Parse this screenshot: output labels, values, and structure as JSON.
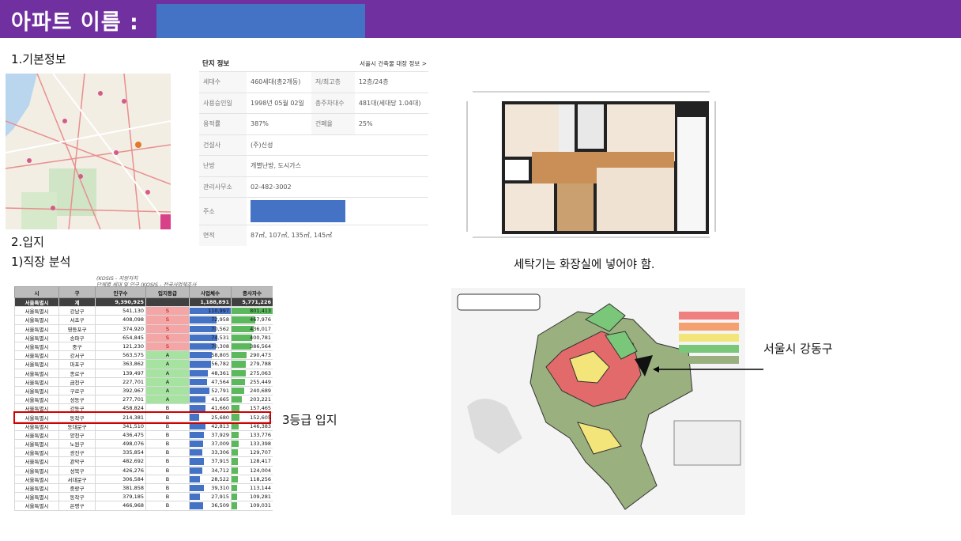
{
  "header": {
    "title": "아파트 이름 :"
  },
  "labels": {
    "basic_info": "1.기본정보",
    "location": "2.입지",
    "job_analysis": "1)직장 분석",
    "grade_note": "3등급 입지",
    "washer_note": "세탁기는 화장실에 넣어야 함.",
    "district_note": "서울시 강동구"
  },
  "complex_info": {
    "title": "단지 정보",
    "link": "서울시 건축물 대장 정보 >",
    "rows": [
      {
        "k1": "세대수",
        "v1": "460세대(총2개동)",
        "k2": "저/최고층",
        "v2": "12층/24층"
      },
      {
        "k1": "사용승인일",
        "v1": "1998년 05월 02일",
        "k2": "총주차대수",
        "v2": "481대(세대당 1.04대)"
      },
      {
        "k1": "용적률",
        "v1": "387%",
        "k2": "건폐율",
        "v2": "25%"
      },
      {
        "k1": "건설사",
        "v1": "(주)신성"
      },
      {
        "k1": "난방",
        "v1": "개별난방, 도시가스"
      },
      {
        "k1": "관리사무소",
        "v1": "02-482-3002"
      },
      {
        "k1": "주소",
        "v1": ""
      },
      {
        "k1": "면적",
        "v1": "87㎡, 107㎡, 135㎡, 145㎡"
      }
    ]
  },
  "job_table": {
    "source1": "(KOSIS - 지방자치",
    "source2": "단체별 세대 및 인구 (KOSIS - 전국사업체조사",
    "columns": [
      "시",
      "구",
      "인구수",
      "입지등급",
      "사업체수",
      "종사자수"
    ],
    "total": {
      "si": "서울특별시",
      "gu": "계",
      "pop": "9,390,925",
      "biz": "1,188,891",
      "emp": "5,771,226"
    },
    "rows": [
      {
        "si": "서울특별시",
        "gu": "강남구",
        "pop": "541,130",
        "grade": "S",
        "biz": "110,997",
        "emp": "801,413",
        "bizv": 110997,
        "empv": 801413
      },
      {
        "si": "서울특별시",
        "gu": "서초구",
        "pop": "408,098",
        "grade": "S",
        "biz": "72,958",
        "emp": "467,976",
        "bizv": 72958,
        "empv": 467976
      },
      {
        "si": "서울특별시",
        "gu": "영등포구",
        "pop": "374,920",
        "grade": "S",
        "biz": "70,562",
        "emp": "436,017",
        "bizv": 70562,
        "empv": 436017
      },
      {
        "si": "서울특별시",
        "gu": "송파구",
        "pop": "654,845",
        "grade": "S",
        "biz": "74,531",
        "emp": "400,781",
        "bizv": 74531,
        "empv": 400781
      },
      {
        "si": "서울특별시",
        "gu": "중구",
        "pop": "121,230",
        "grade": "S",
        "biz": "70,308",
        "emp": "386,564",
        "bizv": 70308,
        "empv": 386564
      },
      {
        "si": "서울특별시",
        "gu": "강서구",
        "pop": "563,575",
        "grade": "A",
        "biz": "58,805",
        "emp": "290,473",
        "bizv": 58805,
        "empv": 290473
      },
      {
        "si": "서울특별시",
        "gu": "마포구",
        "pop": "363,862",
        "grade": "A",
        "biz": "56,782",
        "emp": "279,788",
        "bizv": 56782,
        "empv": 279788
      },
      {
        "si": "서울특별시",
        "gu": "종로구",
        "pop": "139,497",
        "grade": "A",
        "biz": "48,361",
        "emp": "275,063",
        "bizv": 48361,
        "empv": 275063
      },
      {
        "si": "서울특별시",
        "gu": "금천구",
        "pop": "227,701",
        "grade": "A",
        "biz": "47,564",
        "emp": "255,449",
        "bizv": 47564,
        "empv": 255449
      },
      {
        "si": "서울특별시",
        "gu": "구로구",
        "pop": "392,967",
        "grade": "A",
        "biz": "52,791",
        "emp": "240,689",
        "bizv": 52791,
        "empv": 240689
      },
      {
        "si": "서울특별시",
        "gu": "성동구",
        "pop": "277,701",
        "grade": "A",
        "biz": "41,665",
        "emp": "203,221",
        "bizv": 41665,
        "empv": 203221
      },
      {
        "si": "서울특별시",
        "gu": "강동구",
        "pop": "458,824",
        "grade": "B",
        "biz": "41,660",
        "emp": "157,465",
        "bizv": 41660,
        "empv": 157465
      },
      {
        "si": "서울특별시",
        "gu": "동작구",
        "pop": "214,381",
        "grade": "B",
        "biz": "25,680",
        "emp": "152,605",
        "bizv": 25680,
        "empv": 152605
      },
      {
        "si": "서울특별시",
        "gu": "동대문구",
        "pop": "341,510",
        "grade": "B",
        "biz": "42,813",
        "emp": "146,383",
        "bizv": 42813,
        "empv": 146383
      },
      {
        "si": "서울특별시",
        "gu": "양천구",
        "pop": "436,475",
        "grade": "B",
        "biz": "37,929",
        "emp": "133,776",
        "bizv": 37929,
        "empv": 133776
      },
      {
        "si": "서울특별시",
        "gu": "노원구",
        "pop": "498,076",
        "grade": "B",
        "biz": "37,009",
        "emp": "133,398",
        "bizv": 37009,
        "empv": 133398
      },
      {
        "si": "서울특별시",
        "gu": "광진구",
        "pop": "335,854",
        "grade": "B",
        "biz": "33,306",
        "emp": "129,707",
        "bizv": 33306,
        "empv": 129707
      },
      {
        "si": "서울특별시",
        "gu": "관악구",
        "pop": "482,692",
        "grade": "B",
        "biz": "37,915",
        "emp": "128,417",
        "bizv": 37915,
        "empv": 128417
      },
      {
        "si": "서울특별시",
        "gu": "성북구",
        "pop": "426,276",
        "grade": "B",
        "biz": "34,712",
        "emp": "124,004",
        "bizv": 34712,
        "empv": 124004
      },
      {
        "si": "서울특별시",
        "gu": "서대문구",
        "pop": "306,584",
        "grade": "B",
        "biz": "28,522",
        "emp": "118,256",
        "bizv": 28522,
        "empv": 118256
      },
      {
        "si": "서울특별시",
        "gu": "중랑구",
        "pop": "381,858",
        "grade": "B",
        "biz": "39,310",
        "emp": "113,144",
        "bizv": 39310,
        "empv": 113144
      },
      {
        "si": "서울특별시",
        "gu": "동작구",
        "pop": "379,185",
        "grade": "B",
        "biz": "27,915",
        "emp": "109,281",
        "bizv": 27915,
        "empv": 109281
      },
      {
        "si": "서울특별시",
        "gu": "은평구",
        "pop": "466,968",
        "grade": "B",
        "biz": "36,509",
        "emp": "109,031",
        "bizv": 36509,
        "empv": 109031
      }
    ]
  },
  "colors": {
    "header": "#7030a0",
    "placeholder": "#4472c4",
    "grade_S": "#f4a6a6",
    "grade_A": "#a6e3a1",
    "biz_bar": "#4472c4",
    "emp_bar": "#5cb85c",
    "highlight": "#d00000"
  }
}
